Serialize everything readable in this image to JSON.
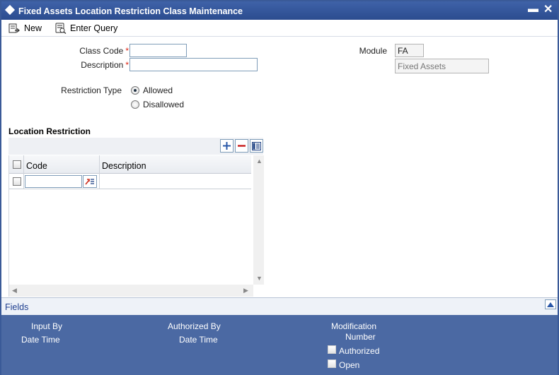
{
  "window": {
    "title": "Fixed Assets Location Restriction Class Maintenance"
  },
  "toolbar": {
    "new_label": "New",
    "enter_query_label": "Enter Query"
  },
  "form": {
    "class_code_label": "Class Code",
    "class_code_value": "",
    "description_label": "Description",
    "description_value": "",
    "required_mark": "*",
    "module_label": "Module",
    "module_value": "FA",
    "module_desc_value": "Fixed Assets",
    "restriction_type_label": "Restriction Type",
    "restriction_options": [
      {
        "label": "Allowed",
        "selected": true
      },
      {
        "label": "Disallowed",
        "selected": false
      }
    ]
  },
  "location_restriction": {
    "title": "Location Restriction",
    "columns": [
      "Code",
      "Description"
    ],
    "rows": [
      {
        "code": "",
        "description": ""
      }
    ]
  },
  "fields_tab": {
    "label": "Fields"
  },
  "audit": {
    "input_by_label": "Input By",
    "date_time_label": "Date Time",
    "authorized_by_label": "Authorized By",
    "auth_date_time_label": "Date Time",
    "modification_label": "Modification",
    "number_label": "Number",
    "authorized_label": "Authorized",
    "open_label": "Open"
  },
  "colors": {
    "title_bar": "#2f519a",
    "footer": "#4b69a3",
    "required": "#dd2211",
    "link": "#1f3f8f"
  }
}
